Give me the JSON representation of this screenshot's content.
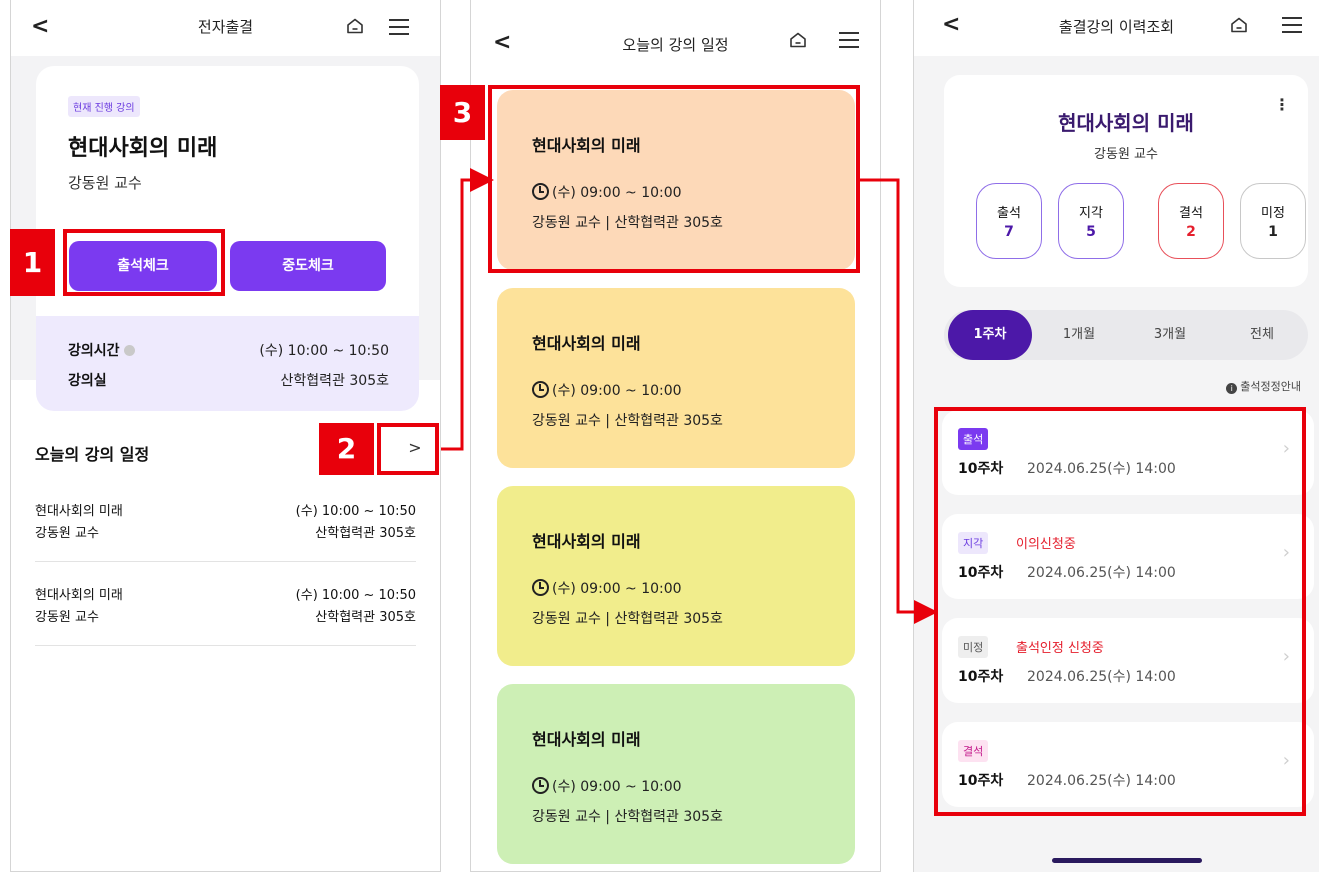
{
  "screen1": {
    "title": "전자출결",
    "back": "<",
    "live_badge": "현재 진행 강의",
    "course": "현대사회의 미래",
    "professor": "강동원 교수",
    "check_in_button": "출석체크",
    "mid_check_button": "중도체크",
    "time_label": "강의시간",
    "time_value": "(수) 10:00 ~ 10:50",
    "room_label": "강의실",
    "room_value": "산학협력관 305호",
    "today_title": "오늘의 강의 일정",
    "more": ">",
    "schedule": [
      {
        "course": "현대사회의 미래",
        "professor": "강동원 교수",
        "time": "(수) 10:00 ~ 10:50",
        "room": "산학협력관 305호"
      },
      {
        "course": "현대사회의 미래",
        "professor": "강동원 교수",
        "time": "(수) 10:00 ~ 10:50",
        "room": "산학협력관 305호"
      }
    ]
  },
  "screen2": {
    "title": "오늘의 강의 일정",
    "back": "<",
    "cards": [
      {
        "course": "현대사회의 미래",
        "time": "(수) 09:00 ~ 10:00",
        "place": "강동원 교수 | 산학협력관 305호",
        "color": "#fdd9b8"
      },
      {
        "course": "현대사회의 미래",
        "time": "(수) 09:00 ~ 10:00",
        "place": "강동원 교수 | 산학협력관 305호",
        "color": "#fde29a"
      },
      {
        "course": "현대사회의 미래",
        "time": "(수) 09:00 ~ 10:00",
        "place": "강동원 교수 | 산학협력관 305호",
        "color": "#f1ed8c"
      },
      {
        "course": "현대사회의 미래",
        "time": "(수) 09:00 ~ 10:00",
        "place": "강동원 교수 | 산학협력관 305호",
        "color": "#cdefb5"
      }
    ]
  },
  "screen3": {
    "title": "출결강의 이력조회",
    "back": "<",
    "kebab": "⋮",
    "course": "현대사회의 미래",
    "professor": "강동원 교수",
    "stats": [
      {
        "label": "출석",
        "value": "7",
        "color": "#8f6ee8",
        "num_color": "#4c18a8"
      },
      {
        "label": "지각",
        "value": "5",
        "color": "#8f6ee8",
        "num_color": "#4c18a8"
      },
      {
        "label": "결석",
        "value": "2",
        "color": "#e8505a",
        "num_color": "#e51f2d"
      },
      {
        "label": "미정",
        "value": "1",
        "color": "#c8c8c8",
        "num_color": "#222222"
      }
    ],
    "tabs": [
      "1주차",
      "1개월",
      "3개월",
      "전체"
    ],
    "active_tab": "1주차",
    "notice": "출석정정안내",
    "notice_icon": "i",
    "records": [
      {
        "badge": "출석",
        "badge_bg": "#7b3af0",
        "badge_fg": "#ffffff",
        "status": "",
        "week": "10주차",
        "date": "2024.06.25(수) 14:00"
      },
      {
        "badge": "지각",
        "badge_bg": "#ede7fc",
        "badge_fg": "#6b3be0",
        "status": "이의신청중",
        "week": "10주차",
        "date": "2024.06.25(수) 14:00"
      },
      {
        "badge": "미정",
        "badge_bg": "#eeeeee",
        "badge_fg": "#555555",
        "status": "출석인정 신청중",
        "week": "10주차",
        "date": "2024.06.25(수) 14:00"
      },
      {
        "badge": "결석",
        "badge_bg": "#fde2f1",
        "badge_fg": "#c2188a",
        "status": "",
        "week": "10주차",
        "date": "2024.06.25(수) 14:00"
      }
    ]
  },
  "annotations": {
    "step1": "1",
    "step2": "2",
    "step3": "3",
    "color": "#e8000b"
  }
}
